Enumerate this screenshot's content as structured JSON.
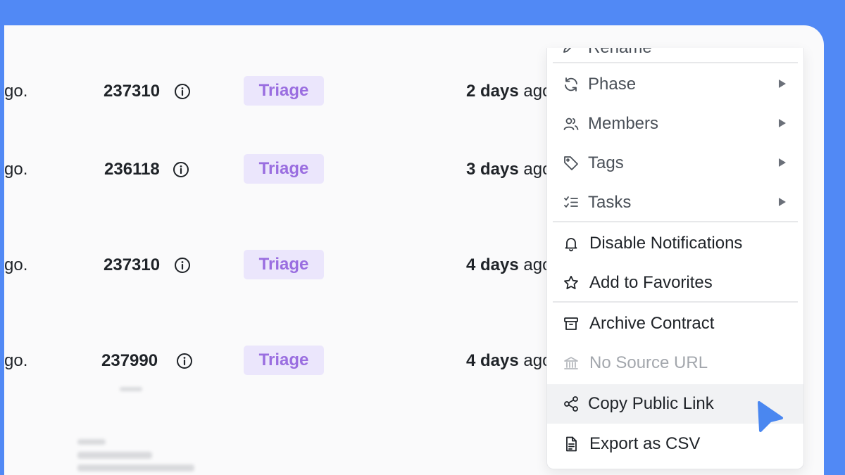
{
  "rows": [
    {
      "ago": "go.",
      "id": "237310",
      "status": "Triage",
      "due_bold": "2 days",
      "due_rest": " ago"
    },
    {
      "ago": "go.",
      "id": "236118",
      "status": "Triage",
      "due_bold": "3 days",
      "due_rest": " ago"
    },
    {
      "ago": "go.",
      "id": "237310",
      "status": "Triage",
      "due_bold": "4 days",
      "due_rest": " ago"
    },
    {
      "ago": "go.",
      "id": "237990",
      "status": "Triage",
      "due_bold": "4 days",
      "due_rest": " ago"
    }
  ],
  "menu": {
    "rename": "Rename",
    "phase": "Phase",
    "members": "Members",
    "tags": "Tags",
    "tasks": "Tasks",
    "disable_notifications": "Disable Notifications",
    "add_to_favorites": "Add to Favorites",
    "archive_contract": "Archive Contract",
    "no_source_url": "No Source URL",
    "copy_public_link": "Copy Public Link",
    "export_csv": "Export as CSV"
  },
  "colors": {
    "frame": "#5189f5",
    "badge_bg": "#ebe6fc",
    "badge_text": "#9a6ee0",
    "cursor": "#4a87f0"
  }
}
